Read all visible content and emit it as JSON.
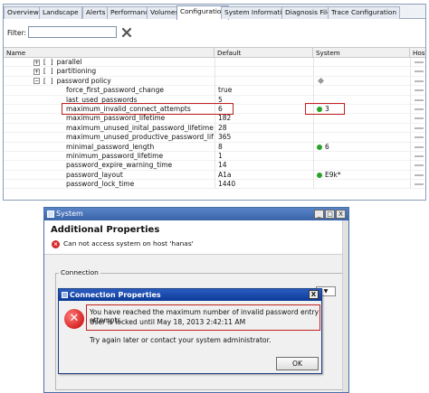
{
  "tabs": [
    "Overview",
    "Landscape",
    "Alerts",
    "Performance",
    "Volumes",
    "Configuration",
    "System Information",
    "Diagnosis Files",
    "Trace Configuration"
  ],
  "active_tab": "Configuration",
  "filter": {
    "label": "Filter:",
    "value": ""
  },
  "columns": {
    "name": "Name",
    "default": "Default",
    "system": "System",
    "host": "Host"
  },
  "rows": [
    {
      "name": "parallel",
      "expander": "+",
      "default": "",
      "system": ""
    },
    {
      "name": "partitioning",
      "expander": "+",
      "default": "",
      "system": ""
    },
    {
      "name": "password policy",
      "expander": "−",
      "default": "",
      "system": ""
    },
    {
      "name": "force_first_password_change",
      "default": "true",
      "system": ""
    },
    {
      "name": "last_used_passwords",
      "default": "5",
      "system": ""
    },
    {
      "name": "maximum_invalid_connect_attempts",
      "default": "6",
      "system": "3"
    },
    {
      "name": "maximum_password_lifetime",
      "default": "182",
      "system": ""
    },
    {
      "name": "maximum_unused_inital_password_lifetime",
      "default": "28",
      "system": ""
    },
    {
      "name": "maximum_unused_productive_password_lifetime",
      "default": "365",
      "system": ""
    },
    {
      "name": "minimal_password_length",
      "default": "8",
      "system": "6"
    },
    {
      "name": "minimum_password_lifetime",
      "default": "1",
      "system": ""
    },
    {
      "name": "password_expire_warning_time",
      "default": "14",
      "system": ""
    },
    {
      "name": "password_layout",
      "default": "A1a",
      "system": "E9k*"
    },
    {
      "name": "password_lock_time",
      "default": "1440",
      "system": ""
    }
  ],
  "system_dialog": {
    "title": "System",
    "heading": "Additional Properties",
    "error": "Can not access system on host 'hanas'",
    "connection_group": "Connection",
    "min": "_",
    "max": "□",
    "close": "X"
  },
  "conn_dialog": {
    "title": "Connection Properties",
    "close": "X",
    "line1": "You have reached the maximum number of invalid password entry attempts.",
    "line2": "User is locked until May 18, 2013 2:42:11 AM",
    "line3": "Try again later or contact your system administrator.",
    "ok": "OK"
  },
  "colors": {
    "title_bar": "#2a5cc0",
    "error_red": "#c42020",
    "status_green": "#29a329"
  }
}
